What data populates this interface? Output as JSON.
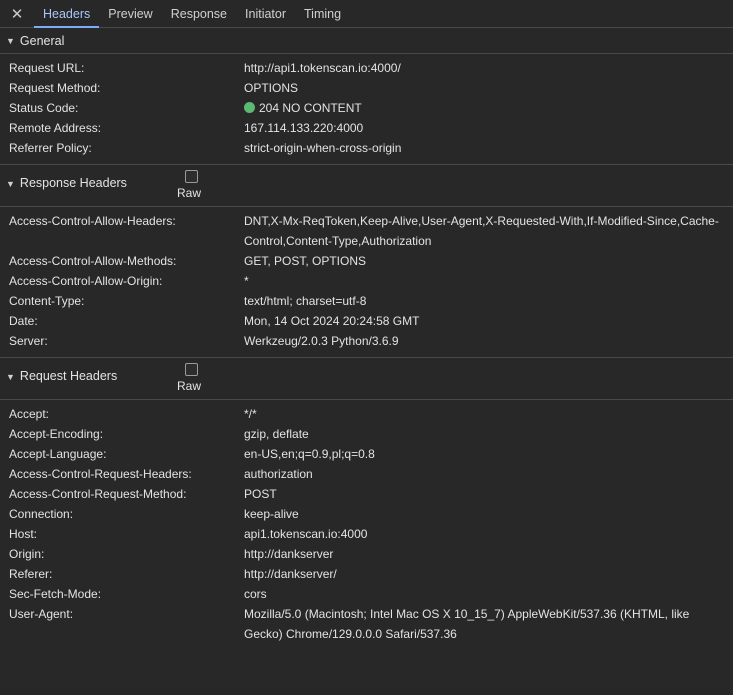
{
  "tabs": [
    {
      "label": "Headers",
      "active": true
    },
    {
      "label": "Preview"
    },
    {
      "label": "Response"
    },
    {
      "label": "Initiator"
    },
    {
      "label": "Timing"
    }
  ],
  "general": {
    "title": "General",
    "rows": [
      {
        "key": "Request URL:",
        "value": "http://api1.tokenscan.io:4000/"
      },
      {
        "key": "Request Method:",
        "value": "OPTIONS"
      },
      {
        "key": "Status Code:",
        "value": "204 NO CONTENT"
      },
      {
        "key": "Remote Address:",
        "value": "167.114.133.220:4000"
      },
      {
        "key": "Referrer Policy:",
        "value": "strict-origin-when-cross-origin"
      }
    ]
  },
  "response_headers": {
    "title": "Response Headers",
    "raw_label": "Raw",
    "rows": [
      {
        "key": "Access-Control-Allow-Headers:",
        "value": "DNT,X-Mx-ReqToken,Keep-Alive,User-Agent,X-Requested-With,If-Modified-Since,Cache-Control,Content-Type,Authorization"
      },
      {
        "key": "Access-Control-Allow-Methods:",
        "value": "GET, POST, OPTIONS"
      },
      {
        "key": "Access-Control-Allow-Origin:",
        "value": "*"
      },
      {
        "key": "Content-Type:",
        "value": "text/html; charset=utf-8"
      },
      {
        "key": "Date:",
        "value": "Mon, 14 Oct 2024 20:24:58 GMT"
      },
      {
        "key": "Server:",
        "value": "Werkzeug/2.0.3 Python/3.6.9"
      }
    ]
  },
  "request_headers": {
    "title": "Request Headers",
    "raw_label": "Raw",
    "rows": [
      {
        "key": "Accept:",
        "value": "*/*"
      },
      {
        "key": "Accept-Encoding:",
        "value": "gzip, deflate"
      },
      {
        "key": "Accept-Language:",
        "value": "en-US,en;q=0.9,pl;q=0.8"
      },
      {
        "key": "Access-Control-Request-Headers:",
        "value": "authorization"
      },
      {
        "key": "Access-Control-Request-Method:",
        "value": "POST"
      },
      {
        "key": "Connection:",
        "value": "keep-alive"
      },
      {
        "key": "Host:",
        "value": "api1.tokenscan.io:4000"
      },
      {
        "key": "Origin:",
        "value": "http://dankserver"
      },
      {
        "key": "Referer:",
        "value": "http://dankserver/"
      },
      {
        "key": "Sec-Fetch-Mode:",
        "value": "cors"
      },
      {
        "key": "User-Agent:",
        "value": "Mozilla/5.0 (Macintosh; Intel Mac OS X 10_15_7) AppleWebKit/537.36 (KHTML, like Gecko) Chrome/129.0.0.0 Safari/537.36"
      }
    ]
  },
  "colors": {
    "status_ok": "#5bb974",
    "accent": "#a8c7fa"
  }
}
